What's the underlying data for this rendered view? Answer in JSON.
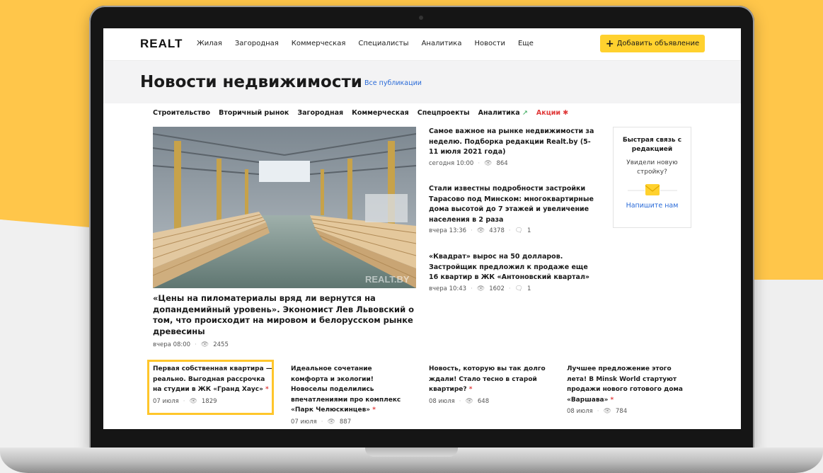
{
  "brand": {
    "logo": "REALT"
  },
  "nav": {
    "items": [
      "Жилая",
      "Загородная",
      "Коммерческая",
      "Специалисты",
      "Аналитика",
      "Новости",
      "Еще"
    ],
    "add_button": "Добавить объявление"
  },
  "header": {
    "title": "Новости недвижимости",
    "all_link": "Все публикации"
  },
  "categories": {
    "items": [
      "Строительство",
      "Вторичный рынок",
      "Загородная",
      "Коммерческая",
      "Спецпроекты"
    ],
    "analytics": "Аналитика",
    "promo": "Акции"
  },
  "hero": {
    "watermark": "REALT.BY",
    "title": "«Цены на пиломатериалы вряд ли вернутся на допандемийный уровень». Экономист Лев Львовский о том, что происходит на мировом и белорусском рынке древесины",
    "time": "вчера 08:00",
    "views": "2455"
  },
  "side_news": [
    {
      "title": "Самое важное на рынке недвижимости за неделю. Подборка редакции Realt.by (5-11 июля 2021 года)",
      "time": "сегодня 10:00",
      "views": "864",
      "comments": ""
    },
    {
      "title": "Стали известны подробности застройки Тарасово под Минском: многоквартирные дома высотой до 7 этажей и увеличение населения в 2 раза",
      "time": "вчера 13:36",
      "views": "4378",
      "comments": "1"
    },
    {
      "title": "«Квадрат» вырос на 50 долларов. Застройщик предложил к продаже еще 16 квартир в ЖК «Антоновский квартал»",
      "time": "вчера 10:43",
      "views": "1602",
      "comments": "1"
    }
  ],
  "feedback": {
    "title": "Быстрая связь с редакцией",
    "question": "Увидели новую стройку?",
    "link": "Напишите нам"
  },
  "bottom_cards": [
    {
      "title": "Первая собственная квартира — реально. Выгодная рассрочка на студии в ЖК «Гранд Хаус»",
      "ad_mark": "*",
      "date": "07 июля",
      "views": "1829"
    },
    {
      "title": "Идеальное сочетание комфорта и экологии! Новоселы поделились впечатлениями про комплекс «Парк Челюскинцев»",
      "ad_mark": "*",
      "date": "07 июля",
      "views": "887"
    },
    {
      "title": "Новость, которую вы так долго ждали! Стало тесно в старой квартире?",
      "ad_mark": "*",
      "date": "08 июля",
      "views": "648"
    },
    {
      "title": "Лучшее предложение этого лета! В Minsk World стартуют продажи нового готового дома «Варшава»",
      "ad_mark": "*",
      "date": "08 июля",
      "views": "784"
    }
  ],
  "colors": {
    "accent": "#ffd12e",
    "link": "#2a6bd8",
    "promo": "#e03b3b",
    "highlight": "#ffc62b"
  }
}
